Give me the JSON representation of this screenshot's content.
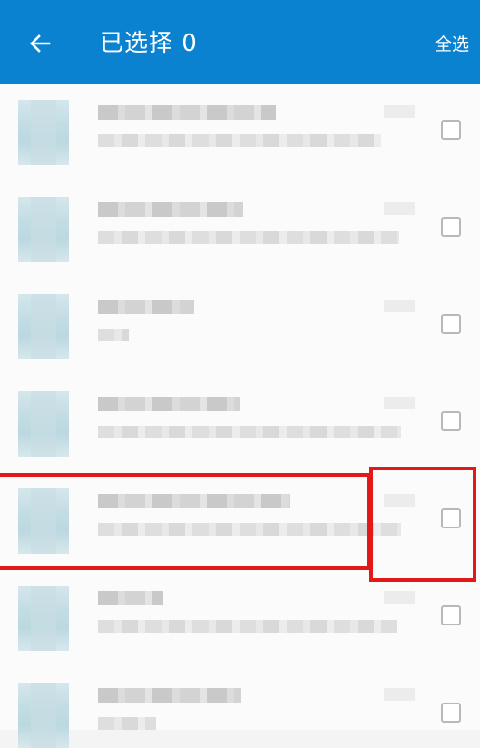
{
  "header": {
    "back_icon": "arrow-left-icon",
    "title": "已选择 0",
    "select_all_label": "全选"
  },
  "colors": {
    "appbar": "#0a82d0",
    "highlight": "#e31919"
  },
  "list": {
    "item_count": 7,
    "highlighted_item_index": 4
  }
}
